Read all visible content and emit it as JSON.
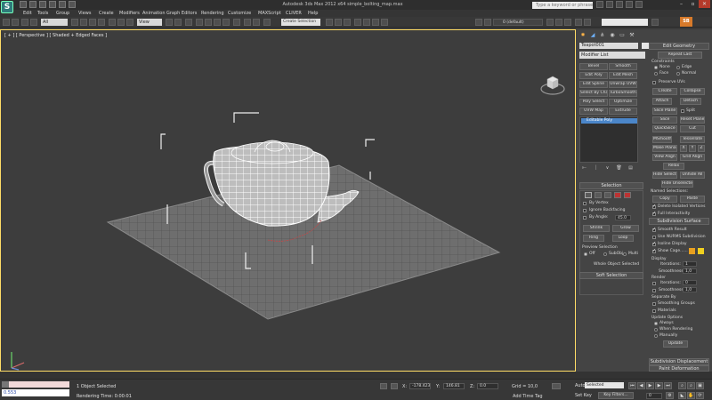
{
  "app": {
    "logo": "S",
    "title": "Autodesk 3ds Max 2012 x64    simple_bolting_map.max",
    "search_placeholder": "Type a keyword or phrase"
  },
  "menu": [
    "Edit",
    "Tools",
    "Group",
    "Views",
    "Create",
    "Modifiers",
    "Animation",
    "Graph Editors",
    "Rendering",
    "Customize",
    "MAXScript",
    "CLIVER",
    "Help"
  ],
  "toolbar": {
    "filter": "All",
    "ref_coord": "View",
    "named_selection": "Create Selection",
    "layer": "0 (default)"
  },
  "viewport": {
    "label": "[ + ] [ Perspective ] [ Shaded + Edged Faces ]"
  },
  "command_panel": {
    "object_name": "Teapot001",
    "modifier_list": "Modifier List",
    "mod_buttons": [
      "Bevel",
      "Smooth",
      "Edit Poly",
      "Edit Mesh",
      "Edit Spline",
      "Unwrap UVW",
      "Select By Chann",
      "TurboSmooth",
      "Poly Select",
      "Optimize",
      "UVW Map",
      "Extrude"
    ],
    "stack_item": "Editable Poly",
    "selection": {
      "title": "Selection",
      "by_vertex": "By Vertex",
      "ignore_backfacing": "Ignore Backfacing",
      "by_angle": "By Angle:",
      "by_angle_val": "45.0",
      "shrink": "Shrink",
      "grow": "Grow",
      "ring": "Ring",
      "loop": "Loop",
      "preview_selection": "Preview Selection",
      "off": "Off",
      "subobj": "SubObj",
      "multi": "Multi",
      "whole_object": "Whole Object Selected"
    },
    "soft_selection": "Soft Selection",
    "edit_geometry": {
      "title": "Edit Geometry",
      "repeat_last": "Repeat Last",
      "constraints": "Constraints",
      "none": "None",
      "edge": "Edge",
      "face": "Face",
      "normal": "Normal",
      "preserve_uvs": "Preserve UVs",
      "create": "Create",
      "collapse": "Collapse",
      "attach": "Attach",
      "detach": "Detach",
      "slice_plane": "Slice Plane",
      "split": "Split",
      "slice": "Slice",
      "reset_plane": "Reset Plane",
      "quickslice": "QuickSlice",
      "cut": "Cut",
      "msmooth": "MSmooth",
      "tessellate": "Tessellate",
      "make_planar": "Make Planar",
      "x": "X",
      "y": "Y",
      "z": "Z",
      "view_align": "View Align",
      "grid_align": "Grid Align",
      "relax": "Relax",
      "hide_selected": "Hide Selected",
      "unhide_all": "Unhide All",
      "hide_unselected": "Hide Unselected",
      "named_selections": "Named Selections:",
      "copy": "Copy",
      "paste": "Paste",
      "delete_isolated": "Delete Isolated Vertices",
      "full_interactivity": "Full Interactivity"
    },
    "subdivision_surface": {
      "title": "Subdivision Surface",
      "smooth_result": "Smooth Result",
      "use_nurms": "Use NURMS Subdivision",
      "isoline_display": "Isoline Display",
      "show_cage": "Show Cage......",
      "display": "Display",
      "iterations_label": "Iterations:",
      "iterations_val": "1",
      "smoothness_label": "Smoothness:",
      "smoothness_val": "1,0",
      "render": "Render",
      "r_iterations_label": "Iterations:",
      "r_iterations_val": "0",
      "r_smoothness_label": "Smoothness:",
      "r_smoothness_val": "1,0",
      "separate_by": "Separate By",
      "smoothing_groups": "Smoothing Groups",
      "materials": "Materials",
      "update_options": "Update Options",
      "always": "Always",
      "when_rendering": "When Rendering",
      "manually": "Manually",
      "update": "Update"
    },
    "subdivision_displacement": "Subdivision Displacement",
    "paint_deformation": "Paint Deformation"
  },
  "status": {
    "listener_text": "0.553",
    "objects_selected": "1 Object Selected",
    "rendering_time": "Rendering Time: 0:00:01",
    "x_label": "X:",
    "x_val": "-178.423",
    "y_label": "Y:",
    "y_val": "146.81",
    "z_label": "Z:",
    "z_val": "0.0",
    "grid": "Grid = 10,0",
    "add_time_tag": "Add Time Tag",
    "auto_key": "Auto Key",
    "set_key": "Set Key",
    "selected": "Selected",
    "key_filters": "Key Filters...",
    "frame": "0"
  },
  "colors": {
    "viewport_bg": "#3d3d3d",
    "active_border": "#ffdd66",
    "stack_highlight": "#4b86c9",
    "cage_orange": "#e8a020",
    "cage_yellow": "#f0d020"
  }
}
